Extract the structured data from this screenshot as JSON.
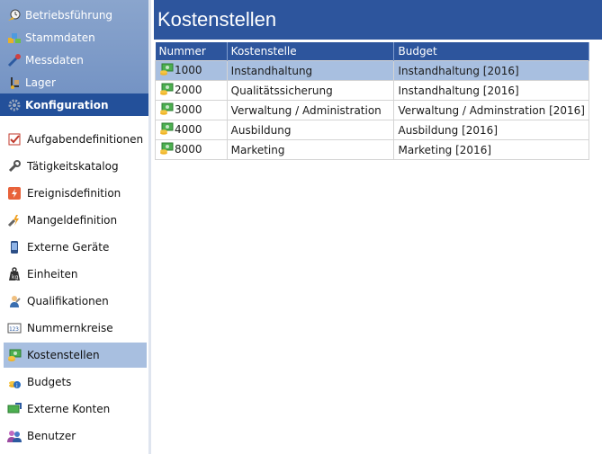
{
  "modules": [
    {
      "label": "Betriebsführung",
      "icon": "operations-icon"
    },
    {
      "label": "Stammdaten",
      "icon": "master-data-icon"
    },
    {
      "label": "Messdaten",
      "icon": "measurement-icon"
    },
    {
      "label": "Lager",
      "icon": "warehouse-icon"
    },
    {
      "label": "Konfiguration",
      "icon": "configuration-icon"
    }
  ],
  "config_items": [
    {
      "label": "Aufgabendefinitionen",
      "icon": "task-definition-icon"
    },
    {
      "label": "Tätigkeitskatalog",
      "icon": "wrench-icon"
    },
    {
      "label": "Ereignisdefinition",
      "icon": "event-icon"
    },
    {
      "label": "Mangeldefinition",
      "icon": "defect-icon"
    },
    {
      "label": "Externe Geräte",
      "icon": "device-icon"
    },
    {
      "label": "Einheiten",
      "icon": "weight-icon"
    },
    {
      "label": "Qualifikationen",
      "icon": "qualification-icon"
    },
    {
      "label": "Nummernkreise",
      "icon": "number-range-icon"
    },
    {
      "label": "Kostenstellen",
      "icon": "cost-center-icon"
    },
    {
      "label": "Budgets",
      "icon": "budget-icon"
    },
    {
      "label": "Externe Konten",
      "icon": "external-account-icon"
    },
    {
      "label": "Benutzer",
      "icon": "users-icon"
    }
  ],
  "page_title": "Kostenstellen",
  "table": {
    "columns": [
      "Nummer",
      "Kostenstelle",
      "Budget"
    ],
    "rows": [
      {
        "nummer": "1000",
        "kostenstelle": "Instandhaltung",
        "budget": "Instandhaltung [2016]"
      },
      {
        "nummer": "2000",
        "kostenstelle": "Qualitätssicherung",
        "budget": "Instandhaltung [2016]"
      },
      {
        "nummer": "3000",
        "kostenstelle": "Verwaltung / Administration",
        "budget": "Verwaltung / Adminstration [2016]"
      },
      {
        "nummer": "4000",
        "kostenstelle": "Ausbildung",
        "budget": "Ausbildung [2016]"
      },
      {
        "nummer": "8000",
        "kostenstelle": "Marketing",
        "budget": "Marketing [2016]"
      }
    ]
  },
  "colors": {
    "accent": "#2d559d",
    "selection": "#a8bfe0",
    "module_bg": "#7f9ccc"
  }
}
